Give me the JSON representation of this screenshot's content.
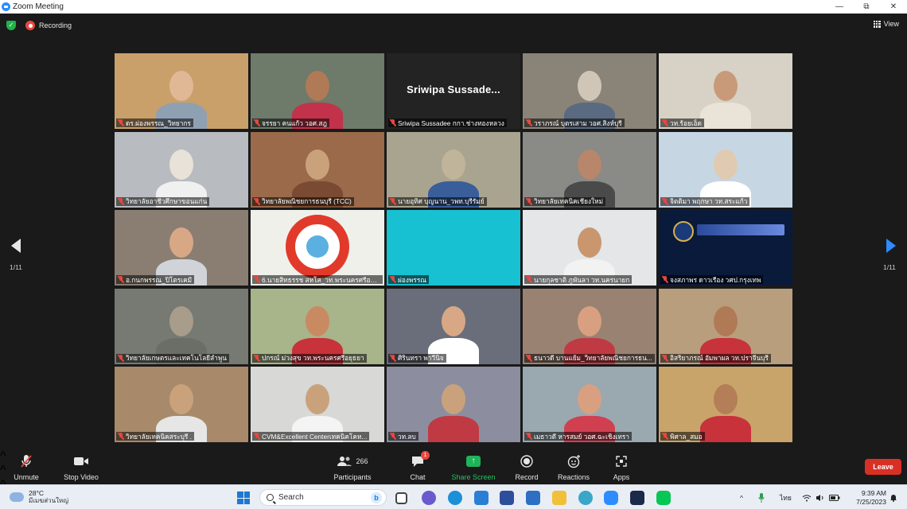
{
  "window": {
    "title": "Zoom Meeting",
    "controls": [
      "—",
      "⧉",
      "✕"
    ]
  },
  "top_bar": {
    "recording_label": "Recording",
    "view_label": "View"
  },
  "pagination": {
    "left_label": "1/11",
    "right_label": "1/11"
  },
  "active_speaker_name": "Sriwipa  Sussade...",
  "participants": [
    {
      "name": "ดร.ผ่องพรรณ_วิทยากร",
      "bg": "#c9a06a",
      "skin": "#e0b896",
      "shirt": "#8fa0b3"
    },
    {
      "name": "จรรยา คนแก้ว วอศ.สฎ",
      "bg": "#6e7a6a",
      "skin": "#b07a56",
      "shirt": "#c2324a"
    },
    {
      "name": "Sriwipa Sussadee กกา.ช่างทองหลวง",
      "bg": "#232323",
      "skin": "",
      "shirt": ""
    },
    {
      "name": "วราภรณ์ บุตรเสาม วอศ.สิงห์บุรี",
      "bg": "#8a8478",
      "skin": "#d0c6b8",
      "shirt": "#5a6a80"
    },
    {
      "name": "วท.ร้อยเอ็ด",
      "bg": "#d8d2c6",
      "skin": "#c89a7a",
      "shirt": "#e9e3d8"
    },
    {
      "name": "วิทยาลัยอาชีวศึกษาขอนแก่น",
      "bg": "#b8bcc0",
      "skin": "#e8e2d8",
      "shirt": "#f0f0f0"
    },
    {
      "name": "วิทยาลัยพณิชยการธนบุรี (TCC)",
      "bg": "#9a6a4a",
      "skin": "#c9a27c",
      "shirt": "#7a4a32"
    },
    {
      "name": "นายอุทิศ บุญนาน_วพท.บุรีรัมย์",
      "bg": "#a9a48f",
      "skin": "#c0b49a",
      "shirt": "#3a5e9a"
    },
    {
      "name": "วิทยาลัยเทคนิคเชียงใหม่",
      "bg": "#8a8a86",
      "skin": "#b8866a",
      "shirt": "#4a4a4a"
    },
    {
      "name": "จิตติมา พฤกษา วท.สระแก้ว",
      "bg": "#c7d6e3",
      "skin": "#e0cab0",
      "shirt": "#ffffff"
    },
    {
      "name": "อ.กนกพรรณ_ปิโตรเคมี",
      "bg": "#8a7e72",
      "skin": "#d8a886",
      "shirt": "#d0d4d8"
    },
    {
      "name": "6.นายสิทธรรช สหโส_วท.พระนครศรีอยุธ...",
      "bg": "#f0f0ea",
      "skin": "",
      "shirt": ""
    },
    {
      "name": "ผ่องพรรณ",
      "bg": "#17c1d2",
      "skin": "",
      "shirt": ""
    },
    {
      "name": "นายกุลชาติ ภูพันลา วท.นครนายก",
      "bg": "#e4e6e8",
      "skin": "#c9966e",
      "shirt": "#f2f2f2"
    },
    {
      "name": "จงสภาพร ดาวเรือง วศป.กรุงเทพ",
      "bg": "#0a1a3a",
      "skin": "",
      "shirt": ""
    },
    {
      "name": "วิทยาลัยเกษตรและเทคโนโลยีลำพูน",
      "bg": "#767a72",
      "skin": "#a89c8a",
      "shirt": "#6a6e66"
    },
    {
      "name": "ปกรณ์ ม่วงสุข วท.พระนครศรีอยุธยา",
      "bg": "#a8b48a",
      "skin": "#c98a62",
      "shirt": "#c8323a"
    },
    {
      "name": "ศิรินทรา พาวีนิจ",
      "bg": "#6a6e7a",
      "skin": "#d8a886",
      "shirt": "#ffffff"
    },
    {
      "name": "ธนาวดี บานแย้ม_วิทยาลัยพณิชยการธน...",
      "bg": "#9a8272",
      "skin": "#d8a080",
      "shirt": "#c03a44"
    },
    {
      "name": "อิสริยาภรณ์ อัมพาผล วท.ปราจีนบุรี",
      "bg": "#b89e7c",
      "skin": "#b07a56",
      "shirt": "#c8323a"
    },
    {
      "name": "วิทยาลัยเทคนิคสระบุรี .",
      "bg": "#a88a6a",
      "skin": "#c9a27c",
      "shirt": "#e6e6e6"
    },
    {
      "name": "CVM&Excellent Centerเทคนิคโคห...",
      "bg": "#d8d8d6",
      "skin": "#c9a27c",
      "shirt": "#f4f4f4"
    },
    {
      "name": "วท.ลบ",
      "bg": "#8c8ea0",
      "skin": "#c9a27c",
      "shirt": "#c03a44"
    },
    {
      "name": "เมธาวดี หารสมย์ วอศ.ฉะเชิงเทรา",
      "bg": "#9aa8b0",
      "skin": "#d8a080",
      "shirt": "#d04050"
    },
    {
      "name": "พิศาล_สมอ",
      "bg": "#c8a46a",
      "skin": "#b47e58",
      "shirt": "#c8323a"
    }
  ],
  "controls": {
    "unmute": "Unmute",
    "stop_video": "Stop Video",
    "participants": "Participants",
    "participant_count": "266",
    "chat": "Chat",
    "chat_badge": "1",
    "share_screen": "Share Screen",
    "record": "Record",
    "reactions": "Reactions",
    "apps": "Apps",
    "leave": "Leave"
  },
  "taskbar": {
    "weather_temp": "28°C",
    "weather_desc": "มีเมฆส่วนใหญ่",
    "search_placeholder": "Search",
    "language": "ไทย",
    "time": "9:39 AM",
    "date": "7/25/2023"
  },
  "colors": {
    "active_speaker_border": "#d6e86a",
    "muted_icon": "#e8473f",
    "share_green": "#22c55e",
    "leave_red": "#d93025",
    "next_page_blue": "#2d8cff"
  }
}
